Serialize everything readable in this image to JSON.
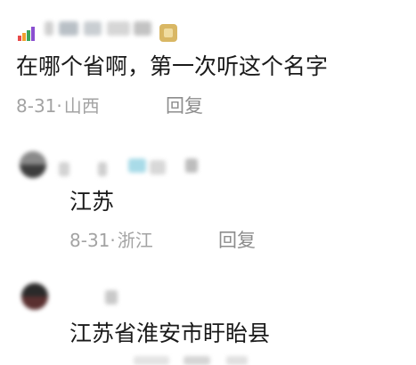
{
  "comments": [
    {
      "text": "在哪个省啊，第一次听这个名字",
      "date": "8-31·",
      "location": "山西",
      "reply_label": "回复"
    }
  ],
  "replies": [
    {
      "text": "江苏",
      "date": "8-31·",
      "location": "浙江",
      "reply_label": "回复"
    },
    {
      "text": "江苏省淮安市盱眙县"
    }
  ],
  "icons": {
    "rank_badge": "rank-badge-icon",
    "medal": "medal-icon",
    "avatar": "avatar"
  },
  "colors": {
    "primary_text": "#1a1a1a",
    "meta_text": "#a3a3a3",
    "reply_link": "#8d8d8d",
    "background": "#ffffff"
  }
}
